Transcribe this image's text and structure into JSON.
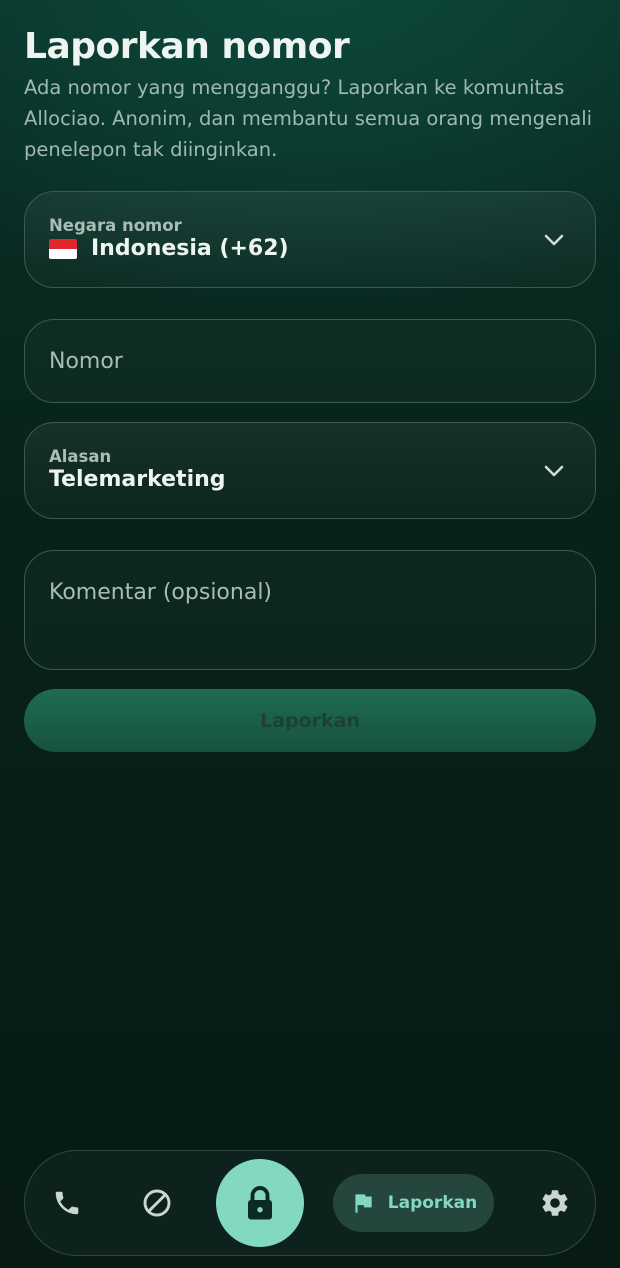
{
  "page": {
    "title": "Laporkan nomor",
    "subtitle": "Ada nomor yang mengganggu? Laporkan ke komunitas Allociao. Anonim, dan membantu semua orang mengenali penelepon tak diinginkan."
  },
  "form": {
    "country": {
      "label": "Negara nomor",
      "value": "Indonesia (+62)",
      "flag_icon": "indonesia-flag-icon"
    },
    "number": {
      "value": "",
      "placeholder": "Nomor"
    },
    "reason": {
      "label": "Alasan",
      "value": "Telemarketing"
    },
    "comment": {
      "value": "",
      "placeholder": "Komentar (opsional)"
    },
    "submit_label": "Laporkan"
  },
  "nav": {
    "items": [
      {
        "icon": "phone-icon"
      },
      {
        "icon": "block-icon"
      },
      {
        "icon": "lock-icon"
      },
      {
        "icon": "flag-icon",
        "label": "Laporkan",
        "active": true
      },
      {
        "icon": "gear-icon"
      }
    ]
  },
  "colors": {
    "accent": "#83d8c2",
    "background_top": "#0a3129",
    "background_bottom": "#071a14",
    "submit_button": "#1f6b54"
  }
}
